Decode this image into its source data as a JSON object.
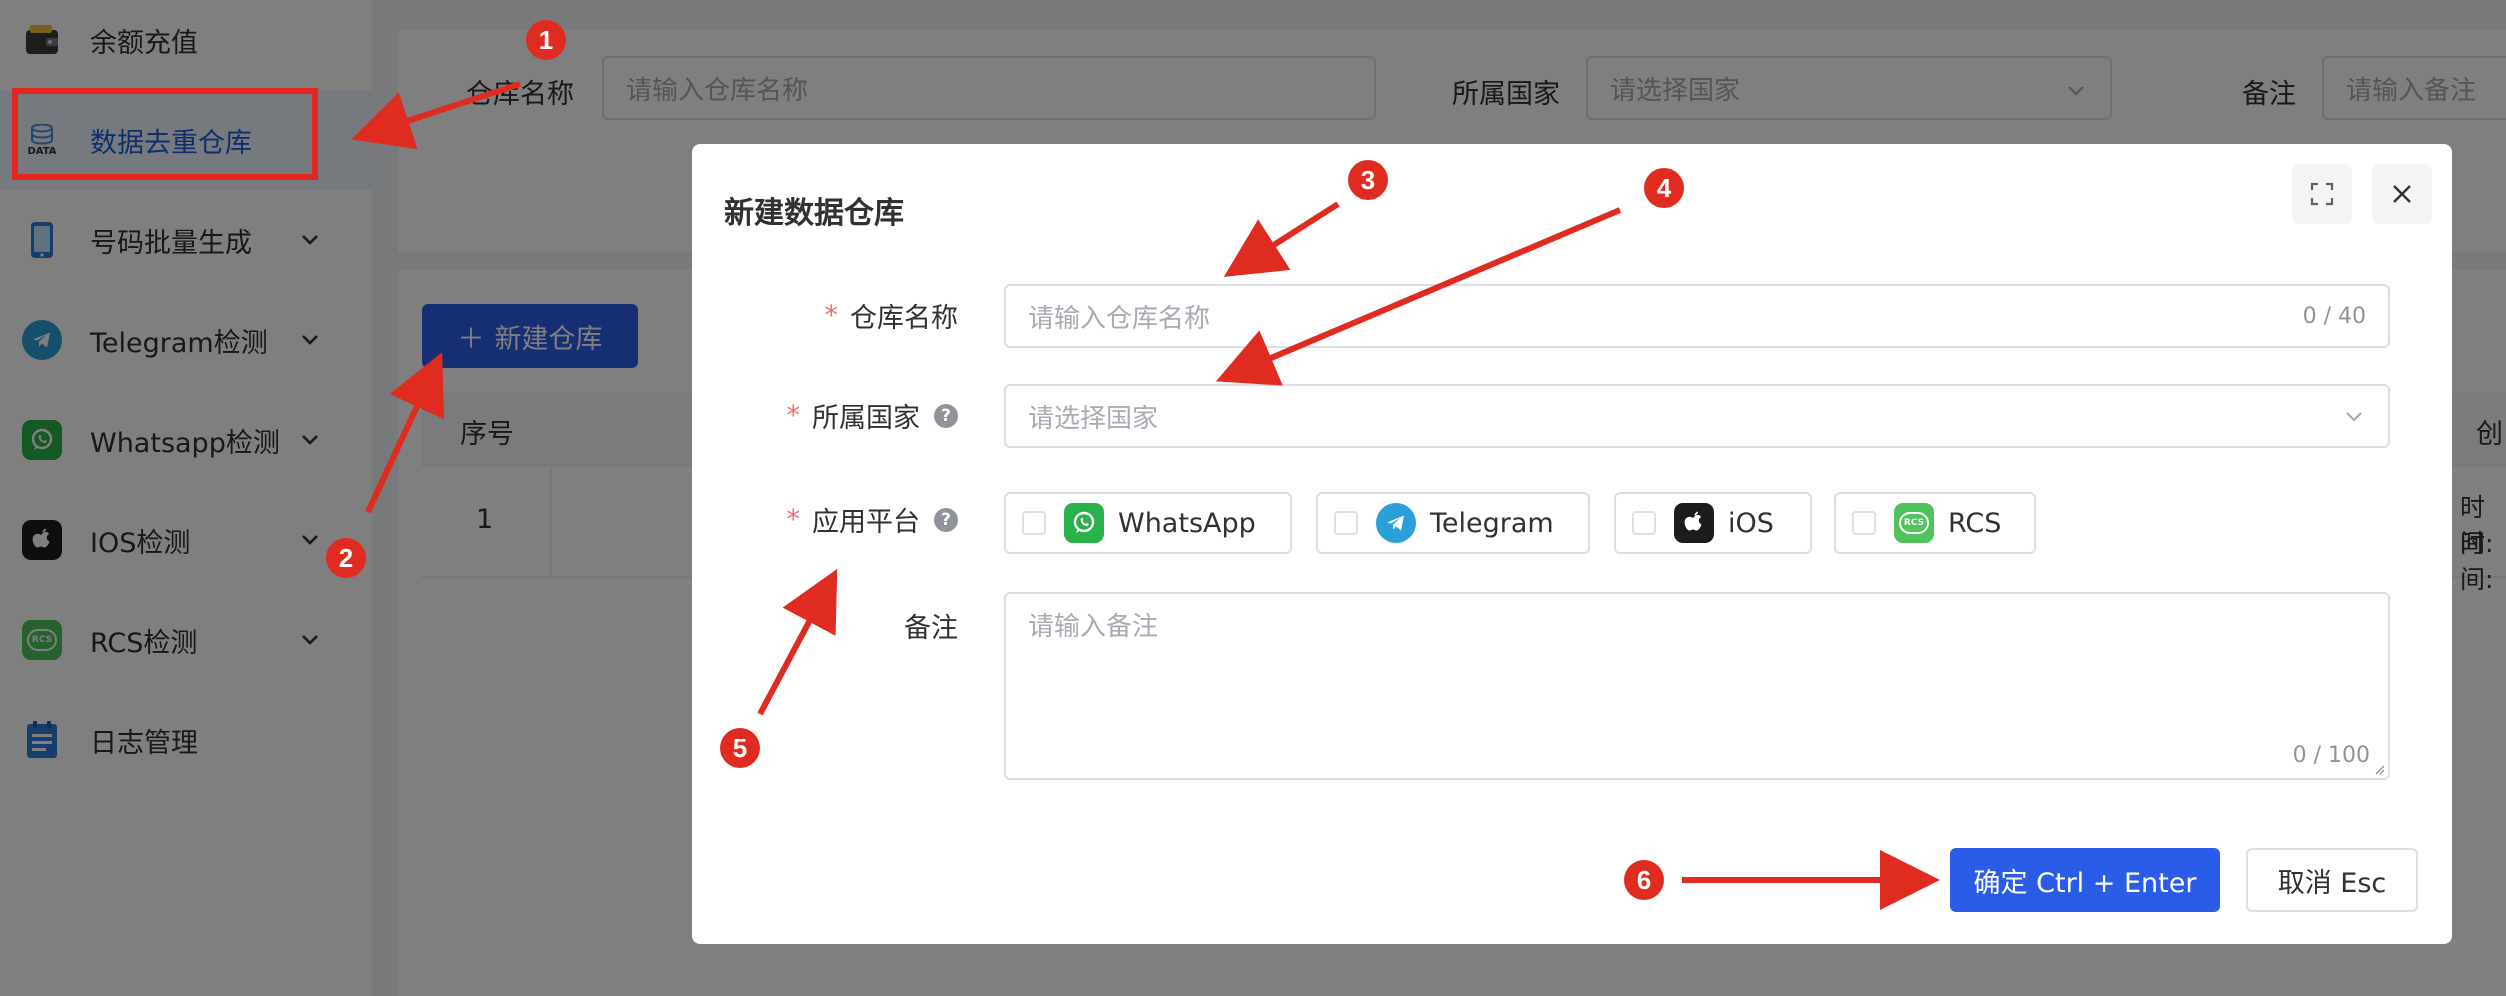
{
  "sidebar": {
    "items": [
      {
        "label": "余额充值",
        "icon": "wallet-icon"
      },
      {
        "label": "数据去重仓库",
        "icon": "data-icon",
        "icon_text": "DATA",
        "active": true
      },
      {
        "label": "号码批量生成",
        "icon": "phone-icon"
      },
      {
        "label": "Telegram检测",
        "icon": "telegram-icon"
      },
      {
        "label": "Whatsapp检测",
        "icon": "whatsapp-icon"
      },
      {
        "label": "IOS检测",
        "icon": "apple-icon"
      },
      {
        "label": "RCS检测",
        "icon": "rcs-icon"
      },
      {
        "label": "日志管理",
        "icon": "log-icon"
      }
    ]
  },
  "search": {
    "name_label": "仓库名称",
    "name_placeholder": "请输入仓库名称",
    "country_label": "所属国家",
    "country_placeholder": "请选择国家",
    "remark_label": "备注",
    "remark_placeholder": "请输入备注"
  },
  "toolbar": {
    "new_label": "新建仓库"
  },
  "table": {
    "headers": [
      "序号",
      "创"
    ],
    "rows": [
      {
        "index": "1",
        "time_lines": [
          "时间:",
          "时间:"
        ]
      }
    ]
  },
  "dialog": {
    "title": "新建数据仓库",
    "name_label": "仓库名称",
    "name_placeholder": "请输入仓库名称",
    "name_count": "0 / 40",
    "country_label": "所属国家",
    "country_placeholder": "请选择国家",
    "platform_label": "应用平台",
    "platforms": [
      "WhatsApp",
      "Telegram",
      "iOS",
      "RCS"
    ],
    "rcs_icon_text": "RCS",
    "remark_label": "备注",
    "remark_placeholder": "请输入备注",
    "remark_count": "0 / 100",
    "confirm_label": "确定 Ctrl + Enter",
    "cancel_label": "取消 Esc",
    "help_mark": "?",
    "required_mark": "*"
  },
  "annotations": [
    "1",
    "2",
    "3",
    "4",
    "5",
    "6"
  ],
  "colors": {
    "primary": "#2a5ce8",
    "annotation_red": "#e02b20",
    "whatsapp": "#2ab24a",
    "telegram": "#2b9fd9",
    "ios": "#1c1c1e",
    "rcs": "#4fc35c"
  }
}
